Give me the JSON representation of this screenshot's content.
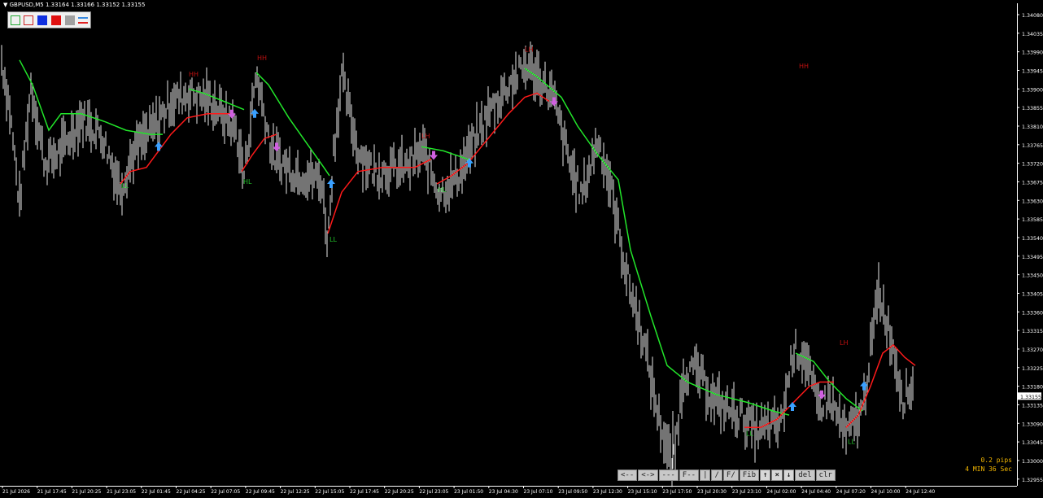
{
  "symbol_title": "GBPUSD,M5  1.33164 1.33166 1.33152 1.33155",
  "price_axis": {
    "ticks": [
      "1.34080",
      "1.34035",
      "1.33990",
      "1.33945",
      "1.33900",
      "1.33855",
      "1.33810",
      "1.33765",
      "1.33720",
      "1.33675",
      "1.33630",
      "1.33585",
      "1.33540",
      "1.33495",
      "1.33450",
      "1.33405",
      "1.33360",
      "1.33315",
      "1.33270",
      "1.33225",
      "1.33180",
      "1.33135",
      "1.33090",
      "1.33045",
      "1.33000",
      "1.32955"
    ],
    "current_price": "1.33155"
  },
  "time_axis": {
    "labels": [
      "21 Jul 2026",
      "21 Jul 17:45",
      "21 Jul 20:25",
      "21 Jul 23:05",
      "22 Jul 01:45",
      "22 Jul 04:25",
      "22 Jul 07:05",
      "22 Jul 09:45",
      "22 Jul 12:25",
      "22 Jul 15:05",
      "22 Jul 17:45",
      "22 Jul 20:25",
      "22 Jul 23:05",
      "23 Jul 01:50",
      "23 Jul 04:30",
      "23 Jul 07:10",
      "23 Jul 09:50",
      "23 Jul 12:30",
      "23 Jul 15:10",
      "23 Jul 17:50",
      "23 Jul 20:30",
      "23 Jul 23:10",
      "24 Jul 02:00",
      "24 Jul 04:40",
      "24 Jul 07:20",
      "24 Jul 10:00",
      "24 Jul 12:40"
    ]
  },
  "swing_labels": [
    {
      "text": "HH",
      "color": "#c01010",
      "price": 1.3393
    },
    {
      "text": "HH",
      "color": "#c01010",
      "price": 1.3397
    },
    {
      "text": "LH",
      "color": "#c01010",
      "price": 1.3399
    },
    {
      "text": "LL",
      "color": "#22c02a",
      "price": 1.3366
    },
    {
      "text": "HL",
      "color": "#22c02a",
      "price": 1.3367
    },
    {
      "text": "LL",
      "color": "#22c02a",
      "price": 1.3353
    },
    {
      "text": "LH",
      "color": "#c01010",
      "price": 1.3378
    },
    {
      "text": "HL",
      "color": "#22c02a",
      "price": 1.3365
    },
    {
      "text": "HH",
      "color": "#c01010",
      "price": 1.3395
    },
    {
      "text": "LL",
      "color": "#22c02a",
      "price": 1.3306
    },
    {
      "text": "LL",
      "color": "#22c02a",
      "price": 1.3304
    },
    {
      "text": "LH",
      "color": "#c01010",
      "price": 1.3328
    }
  ],
  "signal_arrows": [
    {
      "dir": "up",
      "color": "#3aa0ff",
      "price": 1.3376
    },
    {
      "dir": "up",
      "color": "#3aa0ff",
      "price": 1.3384
    },
    {
      "dir": "up",
      "color": "#3aa0ff",
      "price": 1.3367
    },
    {
      "dir": "up",
      "color": "#3aa0ff",
      "price": 1.3372
    },
    {
      "dir": "up",
      "color": "#3aa0ff",
      "price": 1.3313
    },
    {
      "dir": "up",
      "color": "#3aa0ff",
      "price": 1.3318
    },
    {
      "dir": "down",
      "color": "#d060e0",
      "price": 1.3384
    },
    {
      "dir": "down",
      "color": "#d060e0",
      "price": 1.3376
    },
    {
      "dir": "down",
      "color": "#d060e0",
      "price": 1.3374
    },
    {
      "dir": "down",
      "color": "#d060e0",
      "price": 1.3387
    },
    {
      "dir": "down",
      "color": "#d060e0",
      "price": 1.3316
    }
  ],
  "info": {
    "spread": "0.2 pips",
    "countdown": "4 MIN 36 Sec"
  },
  "color_toolbar": {
    "swatches": [
      {
        "name": "green-rect-swatch",
        "fill": "none",
        "border": "#22aa33"
      },
      {
        "name": "red-rect-swatch",
        "fill": "none",
        "border": "#cc2222"
      },
      {
        "name": "blue-swatch",
        "fill": "#1030e0",
        "border": "#1030e0"
      },
      {
        "name": "red-swatch",
        "fill": "#e01010",
        "border": "#e01010"
      },
      {
        "name": "gray-swatch",
        "fill": "#a0a0a0",
        "border": "#a0a0a0"
      },
      {
        "name": "blue-red-line-swatch",
        "fill": "none",
        "border": "none"
      }
    ]
  },
  "nav_buttons": [
    "<--",
    "<->",
    "---",
    "F--",
    "|",
    "/",
    "F/",
    "Fib",
    "↑",
    "×",
    "↓",
    "del",
    "clr"
  ],
  "colors": {
    "background": "#000000",
    "candles": "#e8e8e8",
    "upper_line": "#22e62a",
    "lower_line": "#ff1a1a",
    "axis": "#ffffff"
  }
}
